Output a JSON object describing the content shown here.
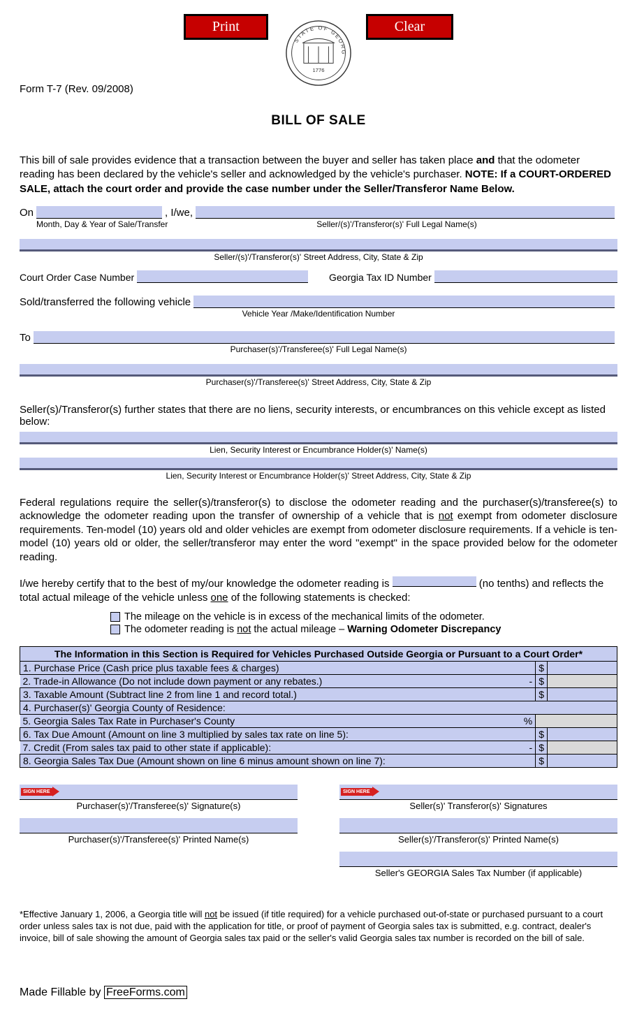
{
  "buttons": {
    "print": "Print",
    "clear": "Clear"
  },
  "form_id": "Form T-7 (Rev. 09/2008)",
  "title": "BILL OF SALE",
  "intro_part1": "This bill of sale provides evidence that a transaction between the buyer and seller has taken place ",
  "intro_and": "and",
  "intro_part2": " that the odometer reading has been declared by the vehicle's seller and acknowledged by the vehicle's purchaser.   ",
  "intro_note": "NOTE:  If a COURT-ORDERED SALE, attach the court order and provide the case number under the Seller/Transferor Name Below.",
  "on_label": "On",
  "iwe_label": ", I/we,",
  "caption_date": "Month, Day & Year of Sale/Transfer",
  "caption_seller_name": "Seller/(s)'/Transferor(s)' Full Legal Name(s)",
  "caption_seller_addr": "Seller/(s)'/Transferor(s)' Street Address, City, State & Zip",
  "court_order_label": "Court Order Case Number",
  "tax_id_label": "Georgia Tax ID Number",
  "sold_label": "Sold/transferred the following vehicle",
  "caption_vehicle": "Vehicle Year /Make/Identification Number",
  "to_label": "To",
  "caption_purchaser_name": "Purchaser(s)'/Transferee(s)' Full Legal Name(s)",
  "caption_purchaser_addr": "Purchaser(s)'/Transferee(s)' Street Address, City, State & Zip",
  "lien_statement": "Seller(s)/Transferor(s) further states that there are no liens, security interests, or encumbrances on this vehicle except as listed below:",
  "caption_lien_name": "Lien, Security Interest or Encumbrance Holder(s)' Name(s)",
  "caption_lien_addr": "Lien, Security Interest or Encumbrance Holder(s)' Street Address, City, State & Zip",
  "fed_para_a": "Federal regulations require the seller(s)/transferor(s) to disclose the odometer reading and the purchaser(s)/transferee(s) to acknowledge the odometer reading upon the transfer of ownership of a vehicle that is ",
  "fed_not": "not",
  "fed_para_b": " exempt from odometer disclosure requirements.  Ten-model (10) years old and older vehicles are exempt from odometer disclosure requirements.  If a vehicle is ten-model (10) years old or older, the seller/transferor may enter the word \"exempt\" in the space provided below for the odometer reading.",
  "certify_a": "I/we hereby certify that to the best of my/our knowledge the odometer reading is ",
  "certify_b": " (no tenths) and reflects the total actual mileage of the vehicle unless ",
  "certify_one": "one",
  "certify_c": " of the following statements is checked:",
  "cb1": "The mileage on the vehicle is in excess of the mechanical limits of the odometer.",
  "cb2_a": "The odometer reading is ",
  "cb2_not": "not",
  "cb2_b": " the actual mileage – ",
  "cb2_warn": "Warning Odometer Discrepancy",
  "table_header": "The Information in this Section is Required for Vehicles Purchased Outside Georgia or Pursuant to a Court Order*",
  "rows": {
    "r1": "1. Purchase Price (Cash price plus taxable fees & charges)",
    "r2": "2. Trade-in Allowance (Do not include down payment or any rebates.)",
    "r3": "3. Taxable Amount (Subtract line 2 from line 1 and record total.)",
    "r4": "4. Purchaser(s)' Georgia County of Residence:",
    "r5": "5. Georgia Sales Tax Rate in Purchaser's County",
    "r6": "6. Tax Due Amount (Amount on line 3 multiplied by sales tax rate on line 5):",
    "r7": "7.  Credit (From sales tax paid to other state if applicable):",
    "r8": "8.  Georgia Sales Tax Due (Amount shown on line 6 minus amount shown on line 7):"
  },
  "sign_here": "SIGN HERE",
  "sig": {
    "purchaser_sig": "Purchaser(s)'/Transferee(s)' Signature(s)",
    "purchaser_name": "Purchaser(s)'/Transferee(s)' Printed Name(s)",
    "seller_sig": "Seller(s)' Transferor(s)' Signatures",
    "seller_name": "Seller(s)'/Transferor(s)' Printed Name(s)",
    "seller_tax": "Seller's GEORGIA Sales Tax Number (if applicable)"
  },
  "footnote_a": "*Effective January 1, 2006, a Georgia title will ",
  "footnote_not": "not",
  "footnote_b": " be issued (if title required) for a vehicle purchased out-of-state or purchased pursuant to a court order unless sales tax is not due, paid with the application for title, or proof of payment of Georgia sales tax is submitted, e.g. contract, dealer's invoice, bill of sale showing the amount of Georgia sales tax paid or the seller's valid Georgia sales tax number is recorded on the bill of sale.",
  "made_by_a": "Made Fillable by ",
  "made_by_b": "FreeForms.com"
}
